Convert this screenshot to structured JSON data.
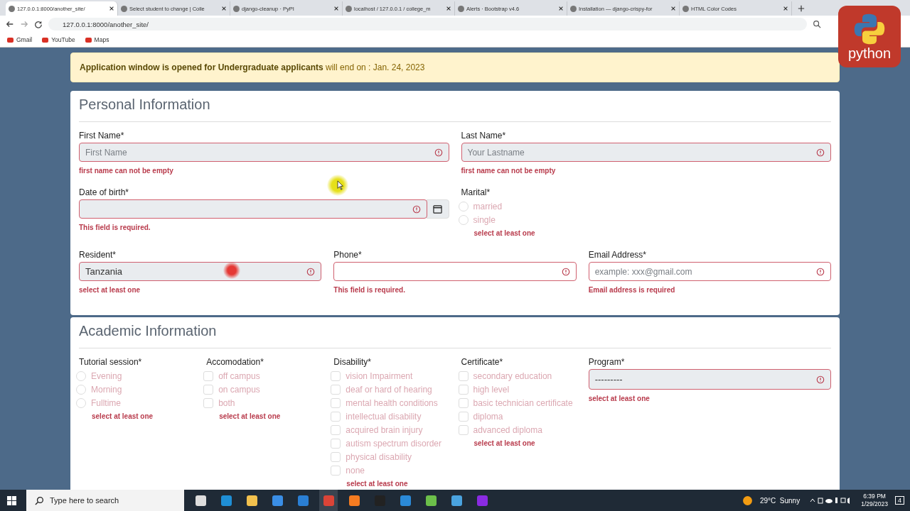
{
  "browser": {
    "tabs": [
      {
        "title": "127.0.0.1:8000/another_site/",
        "selected": true
      },
      {
        "title": "Select student to change | Colle",
        "selected": false
      },
      {
        "title": "django-cleanup · PyPI",
        "selected": false
      },
      {
        "title": "localhost / 127.0.0.1 / college_m",
        "selected": false
      },
      {
        "title": "Alerts · Bootstrap v4.6",
        "selected": false
      },
      {
        "title": "Installation — django-crispy-for",
        "selected": false
      },
      {
        "title": "HTML Color Codes",
        "selected": false
      }
    ],
    "url": "127.0.0.1:8000/another_site/",
    "bookmarks": [
      "Gmail",
      "YouTube",
      "Maps"
    ]
  },
  "logo_badge": "python",
  "alert": "**Application window is opened for Undergraduate applicants** will end on : Jan. 24, 2023",
  "personal": {
    "title": "Personal Information",
    "rows": [
      [
        {
          "kind": "input",
          "label": "First Name*",
          "placeholder": "First Name",
          "disabled": true,
          "invalid": true,
          "error": "first name can not be empty"
        },
        {
          "kind": "input",
          "label": "Last Name*",
          "placeholder": "Your Lastname",
          "disabled": true,
          "invalid": true,
          "error": "first name can not be empty"
        }
      ],
      [
        {
          "kind": "date",
          "label": "Date of birth*",
          "disabled": true,
          "invalid": true,
          "error": "This field is required."
        },
        {
          "kind": "radio_group",
          "label": "Marital*",
          "options": [
            {
              "label": "married",
              "checked": false
            },
            {
              "label": "single",
              "checked": false
            }
          ],
          "error": "select at least one"
        }
      ],
      [
        {
          "kind": "input",
          "label": "Resident*",
          "value": "Tanzania",
          "disabled": true,
          "invalid": true,
          "error": "select at least one"
        },
        {
          "kind": "input",
          "label": "Phone*",
          "disabled": false,
          "invalid": true,
          "error": "This field is required."
        },
        {
          "kind": "input",
          "label": "Email Address*",
          "placeholder": "example: xxx@gmail.com",
          "disabled": false,
          "invalid": true,
          "error": "Email address is required"
        }
      ]
    ]
  },
  "academic": {
    "title": "Academic Information",
    "groups": [
      {
        "kind": "radio_group",
        "label": "Tutorial session*",
        "options": [
          {
            "label": "Evening",
            "checked": false
          },
          {
            "label": "Morning",
            "checked": false
          },
          {
            "label": "Fulltime",
            "checked": false
          }
        ],
        "error": "select at least one"
      },
      {
        "kind": "checkbox_group",
        "label": "Accomodation*",
        "options": [
          {
            "label": "off campus",
            "checked": false
          },
          {
            "label": "on campus",
            "checked": false
          },
          {
            "label": "both",
            "checked": false
          }
        ],
        "error": "select at least one"
      },
      {
        "kind": "checkbox_group",
        "label": "Disability*",
        "options": [
          {
            "label": "vision Impairment",
            "checked": false
          },
          {
            "label": "deaf or hard of hearing",
            "checked": false
          },
          {
            "label": "mental health conditions",
            "checked": false
          },
          {
            "label": "intellectual disability",
            "checked": false
          },
          {
            "label": "acquired brain injury",
            "checked": false
          },
          {
            "label": "autism spectrum disorder",
            "checked": false
          },
          {
            "label": "physical disability",
            "checked": false
          },
          {
            "label": "none",
            "checked": false
          }
        ],
        "error": "select at least one"
      },
      {
        "kind": "checkbox_group",
        "label": "Certificate*",
        "options": [
          {
            "label": "secondary education",
            "checked": false
          },
          {
            "label": "high level",
            "checked": false
          },
          {
            "label": "basic technician certificate",
            "checked": false
          },
          {
            "label": "diploma",
            "checked": false
          },
          {
            "label": "advanced diploma",
            "checked": false
          }
        ],
        "error": "select at least one"
      },
      {
        "kind": "input",
        "label": "Program*",
        "value": "---------",
        "disabled": true,
        "invalid": true,
        "error": "select at least one"
      }
    ]
  },
  "taskbar": {
    "search_placeholder": "Type here to search",
    "weather": "29°C  Sunny",
    "time": "6:39 PM",
    "date": "1/29/2023",
    "notifications": "4"
  }
}
